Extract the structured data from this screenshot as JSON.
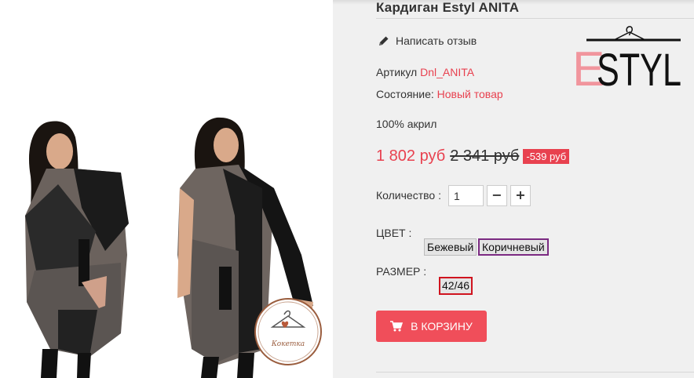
{
  "product": {
    "title": "Кардиган Estyl ANITA",
    "review_link": "Написать отзыв",
    "article_label": "Артикул",
    "article_value": "Dnl_ANITA",
    "condition_label": "Состояние:",
    "condition_value": "Новый товар",
    "material": "100% акрил"
  },
  "brand_logo": {
    "text_accent": "E",
    "text_main": "STYL"
  },
  "watermark": {
    "text": "Кокетка"
  },
  "pricing": {
    "price": "1 802 руб",
    "old_price": "2 341 руб",
    "discount": "-539 руб"
  },
  "quantity": {
    "label": "Количество :",
    "value": "1",
    "minus": "−",
    "plus": "+"
  },
  "color": {
    "label": "ЦВЕТ :",
    "options": [
      "Бежевый",
      "Коричневый"
    ],
    "selected": "Коричневый"
  },
  "size": {
    "label": "РАЗМЕР :",
    "options": [
      "42/46"
    ],
    "selected": "42/46"
  },
  "cart": {
    "label": "В КОРЗИНУ"
  },
  "colors": {
    "accent": "#e8414f",
    "selected_color_border": "#7b2a82",
    "selected_size_border": "#d0141f",
    "panel_bg": "#f0f0f0"
  }
}
